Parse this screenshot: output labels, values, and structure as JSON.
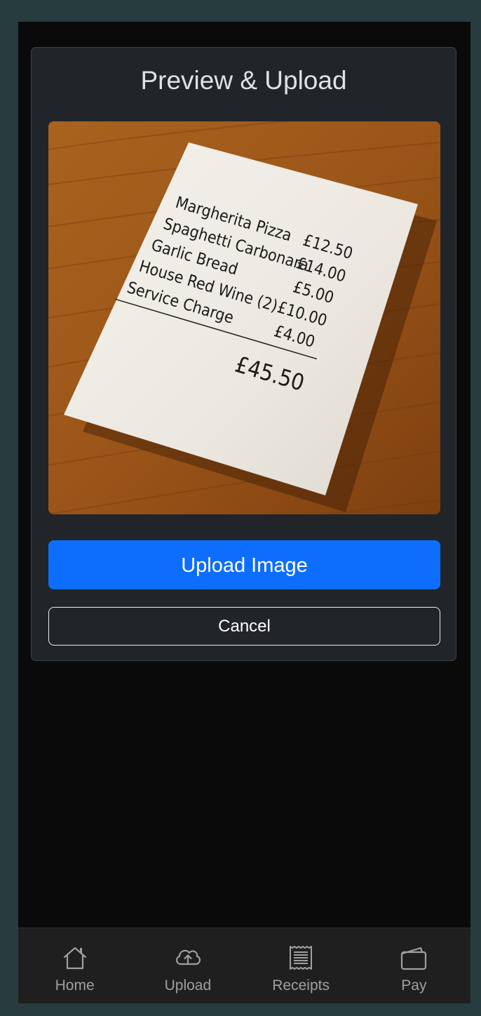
{
  "card": {
    "title": "Preview & Upload"
  },
  "preview": {
    "receipt_lines": [
      {
        "item": "Margherita Pizza",
        "price": "£12.50"
      },
      {
        "item": "Spaghetti Carbonara",
        "price": "£14.00"
      },
      {
        "item": "Garlic Bread",
        "price": "£5.00"
      },
      {
        "item": "House Red Wine (2)",
        "price": "£10.00"
      },
      {
        "item": "Service Charge",
        "price": "£4.00"
      }
    ],
    "total": "£45.50"
  },
  "actions": {
    "upload_label": "Upload Image",
    "cancel_label": "Cancel"
  },
  "nav": {
    "items": [
      {
        "label": "Home",
        "icon": "home-icon"
      },
      {
        "label": "Upload",
        "icon": "cloud-upload-icon"
      },
      {
        "label": "Receipts",
        "icon": "receipt-icon"
      },
      {
        "label": "Pay",
        "icon": "wallet-icon"
      }
    ]
  },
  "colors": {
    "primary": "#0d6efd",
    "card_bg": "#212529",
    "page_bg": "#0a0a0a",
    "nav_bg": "#1f1f1f"
  }
}
